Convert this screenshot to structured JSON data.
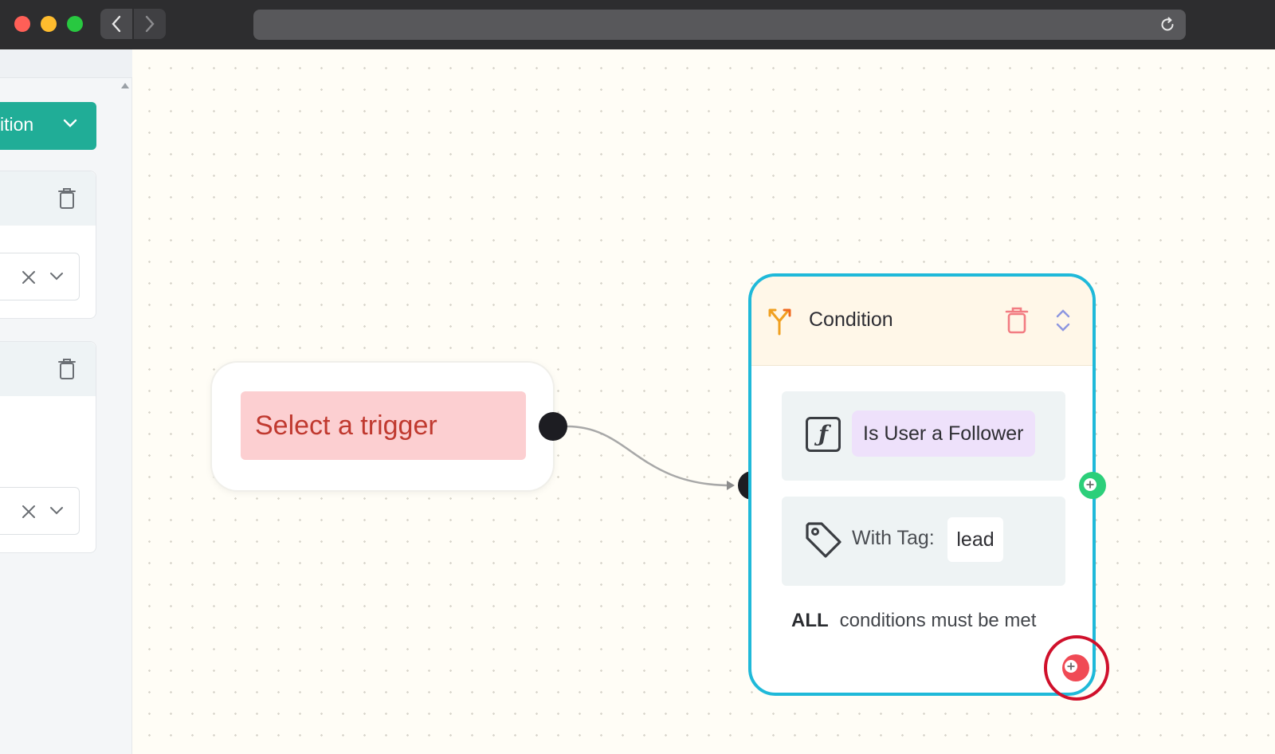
{
  "browser": {
    "traffic_lights": [
      "#ff5f57",
      "#febc2e",
      "#28c840"
    ],
    "back_icon": "chevron-left-icon",
    "forward_icon": "chevron-right-icon",
    "reload_icon": "reload-icon"
  },
  "sidebar": {
    "dropdown_label": "ition",
    "cards": [
      {
        "delete_icon": "trash-icon",
        "select_clear_icon": "close-icon",
        "select_expand_icon": "chevron-down-icon"
      },
      {
        "delete_icon": "trash-icon",
        "select_clear_icon": "close-icon",
        "select_expand_icon": "chevron-down-icon"
      }
    ]
  },
  "trigger_node": {
    "label": "Select a trigger"
  },
  "condition_node": {
    "title": "Condition",
    "rules": [
      {
        "type": "function",
        "label": "Is User a Follower"
      },
      {
        "type": "tag",
        "label": "With Tag:",
        "value": "lead"
      }
    ],
    "match_mode": "ALL",
    "match_text": "conditions must be met"
  },
  "colors": {
    "accent": "#20ad97",
    "node_border": "#1fb9d9",
    "port_true": "#2ccf7a",
    "port_false": "#f04a55",
    "highlight": "#d0102b",
    "trigger_bg": "#fccfd1"
  }
}
